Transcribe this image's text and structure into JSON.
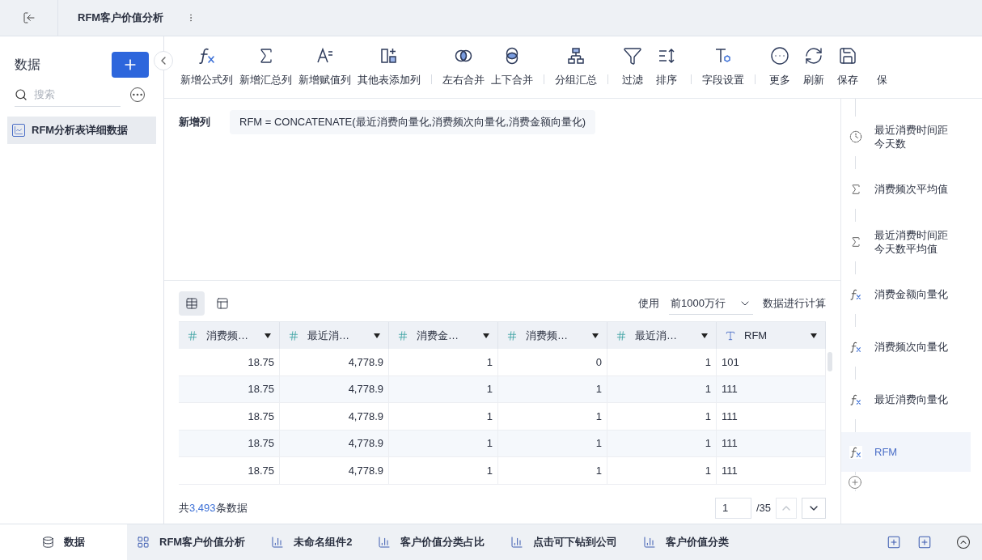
{
  "header": {
    "title": "RFM客户价值分析"
  },
  "sidebar": {
    "title": "数据",
    "search": {
      "placeholder": "搜索"
    },
    "items": [
      {
        "label": "RFM分析表详细数据",
        "selected": true
      }
    ]
  },
  "toolbar": {
    "groups": [
      [
        {
          "label": "新增公式列"
        },
        {
          "label": "新增汇总列"
        },
        {
          "label": "新增赋值列"
        },
        {
          "label": "其他表添加列"
        }
      ],
      [
        {
          "label": "左右合并"
        },
        {
          "label": "上下合并"
        }
      ],
      [
        {
          "label": "分组汇总"
        }
      ],
      [
        {
          "label": "过滤"
        },
        {
          "label": "排序"
        }
      ],
      [
        {
          "label": "字段设置"
        }
      ],
      [
        {
          "label": "更多"
        },
        {
          "label": "刷新"
        },
        {
          "label": "保存"
        },
        {
          "label": "保"
        }
      ]
    ]
  },
  "formula": {
    "label": "新增列",
    "value": "RFM = CONCATENATE(最近消费向量化,消费频次向量化,消费金额向量化)"
  },
  "table_bar": {
    "prefix": "使用",
    "select": "前1000万行",
    "suffix": "数据进行计算",
    "views": [
      {
        "selected": true
      },
      {
        "selected": false
      }
    ]
  },
  "table": {
    "columns": [
      {
        "label": "消费频…",
        "kind": "number"
      },
      {
        "label": "最近消…",
        "kind": "number"
      },
      {
        "label": "消费金…",
        "kind": "number"
      },
      {
        "label": "消费频…",
        "kind": "number"
      },
      {
        "label": "最近消…",
        "kind": "number"
      },
      {
        "label": "RFM",
        "kind": "text"
      }
    ],
    "rows": [
      [
        "18.75",
        "4,778.9",
        "1",
        "0",
        "1",
        "101"
      ],
      [
        "18.75",
        "4,778.9",
        "1",
        "1",
        "1",
        "111"
      ],
      [
        "18.75",
        "4,778.9",
        "1",
        "1",
        "1",
        "111"
      ],
      [
        "18.75",
        "4,778.9",
        "1",
        "1",
        "1",
        "111"
      ],
      [
        "18.75",
        "4,778.9",
        "1",
        "1",
        "1",
        "111"
      ]
    ]
  },
  "footer": {
    "prefix": "共",
    "count": "3,493",
    "suffix": "条数据",
    "page": "1",
    "pages": "/35"
  },
  "steps": [
    {
      "label": "最近消费时间距今天数",
      "kind": "clock",
      "selected": false
    },
    {
      "label": "消费频次平均值",
      "kind": "sum",
      "selected": false
    },
    {
      "label": "最近消费时间距今天数平均值",
      "kind": "sum",
      "selected": false
    },
    {
      "label": "消费金额向量化",
      "kind": "formula",
      "selected": false
    },
    {
      "label": "消费频次向量化",
      "kind": "formula",
      "selected": false
    },
    {
      "label": "最近消费向量化",
      "kind": "formula",
      "selected": false
    },
    {
      "label": "RFM",
      "kind": "formula",
      "selected": true
    }
  ],
  "bottom_tabs": [
    {
      "label": "数据",
      "kind": "data",
      "selected": true
    },
    {
      "label": "RFM客户价值分析",
      "kind": "dashboard",
      "selected": false
    },
    {
      "label": "未命名组件2",
      "kind": "chart",
      "selected": false
    },
    {
      "label": "客户价值分类占比",
      "kind": "chart",
      "selected": false
    },
    {
      "label": "点击可下钻到公司",
      "kind": "chart",
      "selected": false
    },
    {
      "label": "客户价值分类",
      "kind": "chart",
      "selected": false
    }
  ]
}
